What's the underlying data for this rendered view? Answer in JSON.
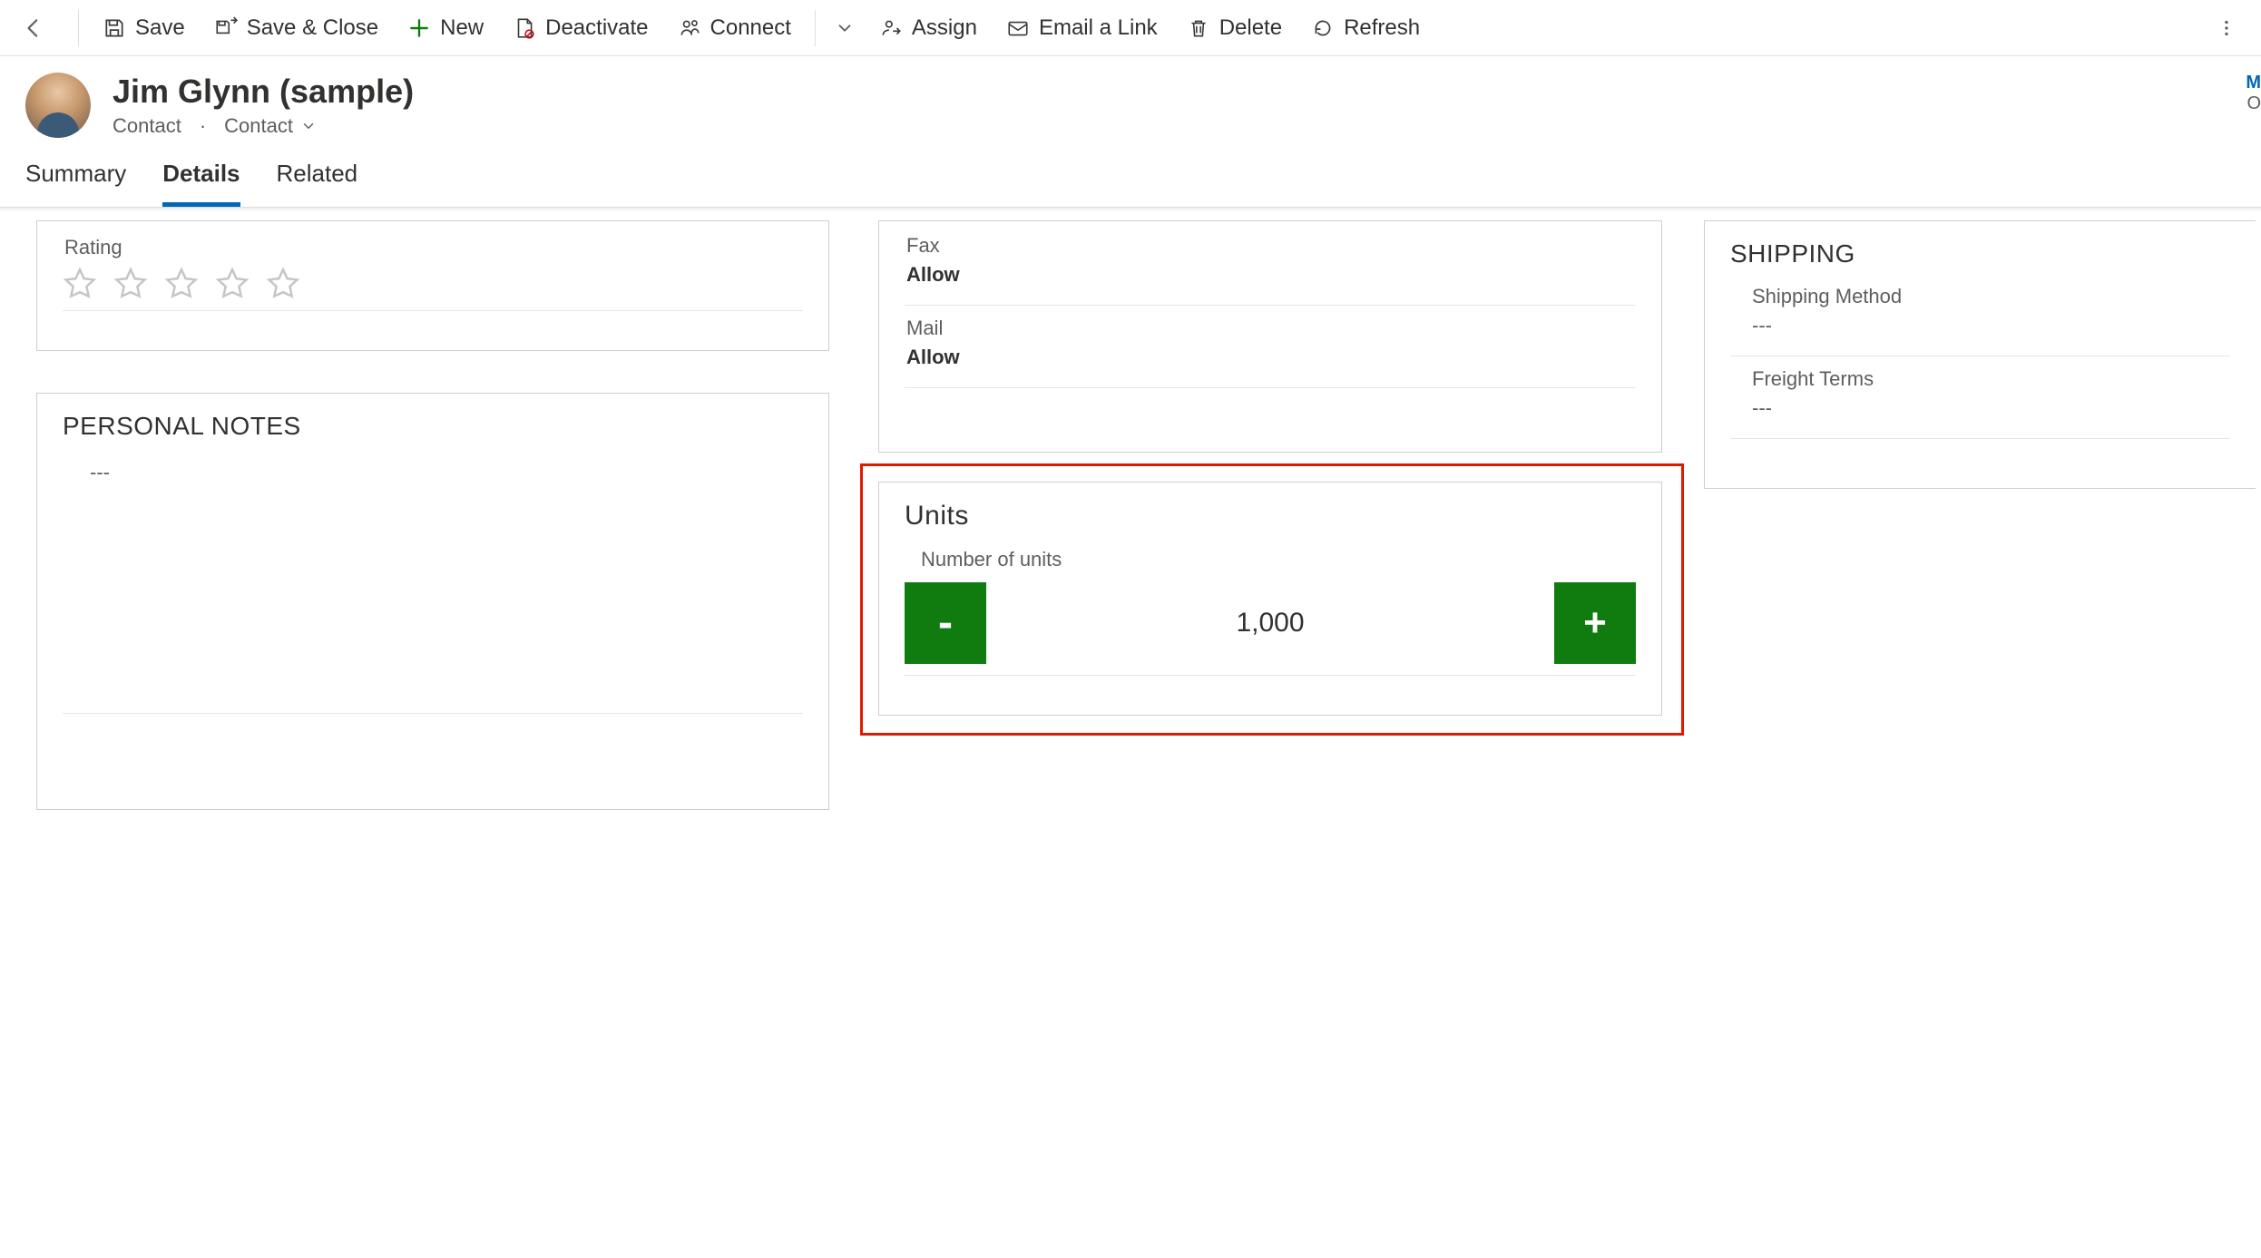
{
  "toolbar": {
    "save": "Save",
    "save_close": "Save & Close",
    "new": "New",
    "deactivate": "Deactivate",
    "connect": "Connect",
    "assign": "Assign",
    "email_link": "Email a Link",
    "delete": "Delete",
    "refresh": "Refresh"
  },
  "header": {
    "title": "Jim Glynn (sample)",
    "entity": "Contact",
    "form": "Contact",
    "right_partial_top": "M",
    "right_partial_bottom": "O"
  },
  "tabs": {
    "summary": "Summary",
    "details": "Details",
    "related": "Related",
    "active": "Details"
  },
  "col1": {
    "rating_label": "Rating",
    "rating_stars": 5,
    "personal_notes_title": "PERSONAL NOTES",
    "personal_notes_value": "---"
  },
  "col2": {
    "fax_label": "Fax",
    "fax_value": "Allow",
    "mail_label": "Mail",
    "mail_value": "Allow",
    "units_title": "Units",
    "units_label": "Number of units",
    "units_value": "1,000",
    "minus": "-",
    "plus": "+"
  },
  "col3": {
    "shipping_title": "SHIPPING",
    "shipping_method_label": "Shipping Method",
    "shipping_method_value": "---",
    "freight_terms_label": "Freight Terms",
    "freight_terms_value": "---"
  }
}
